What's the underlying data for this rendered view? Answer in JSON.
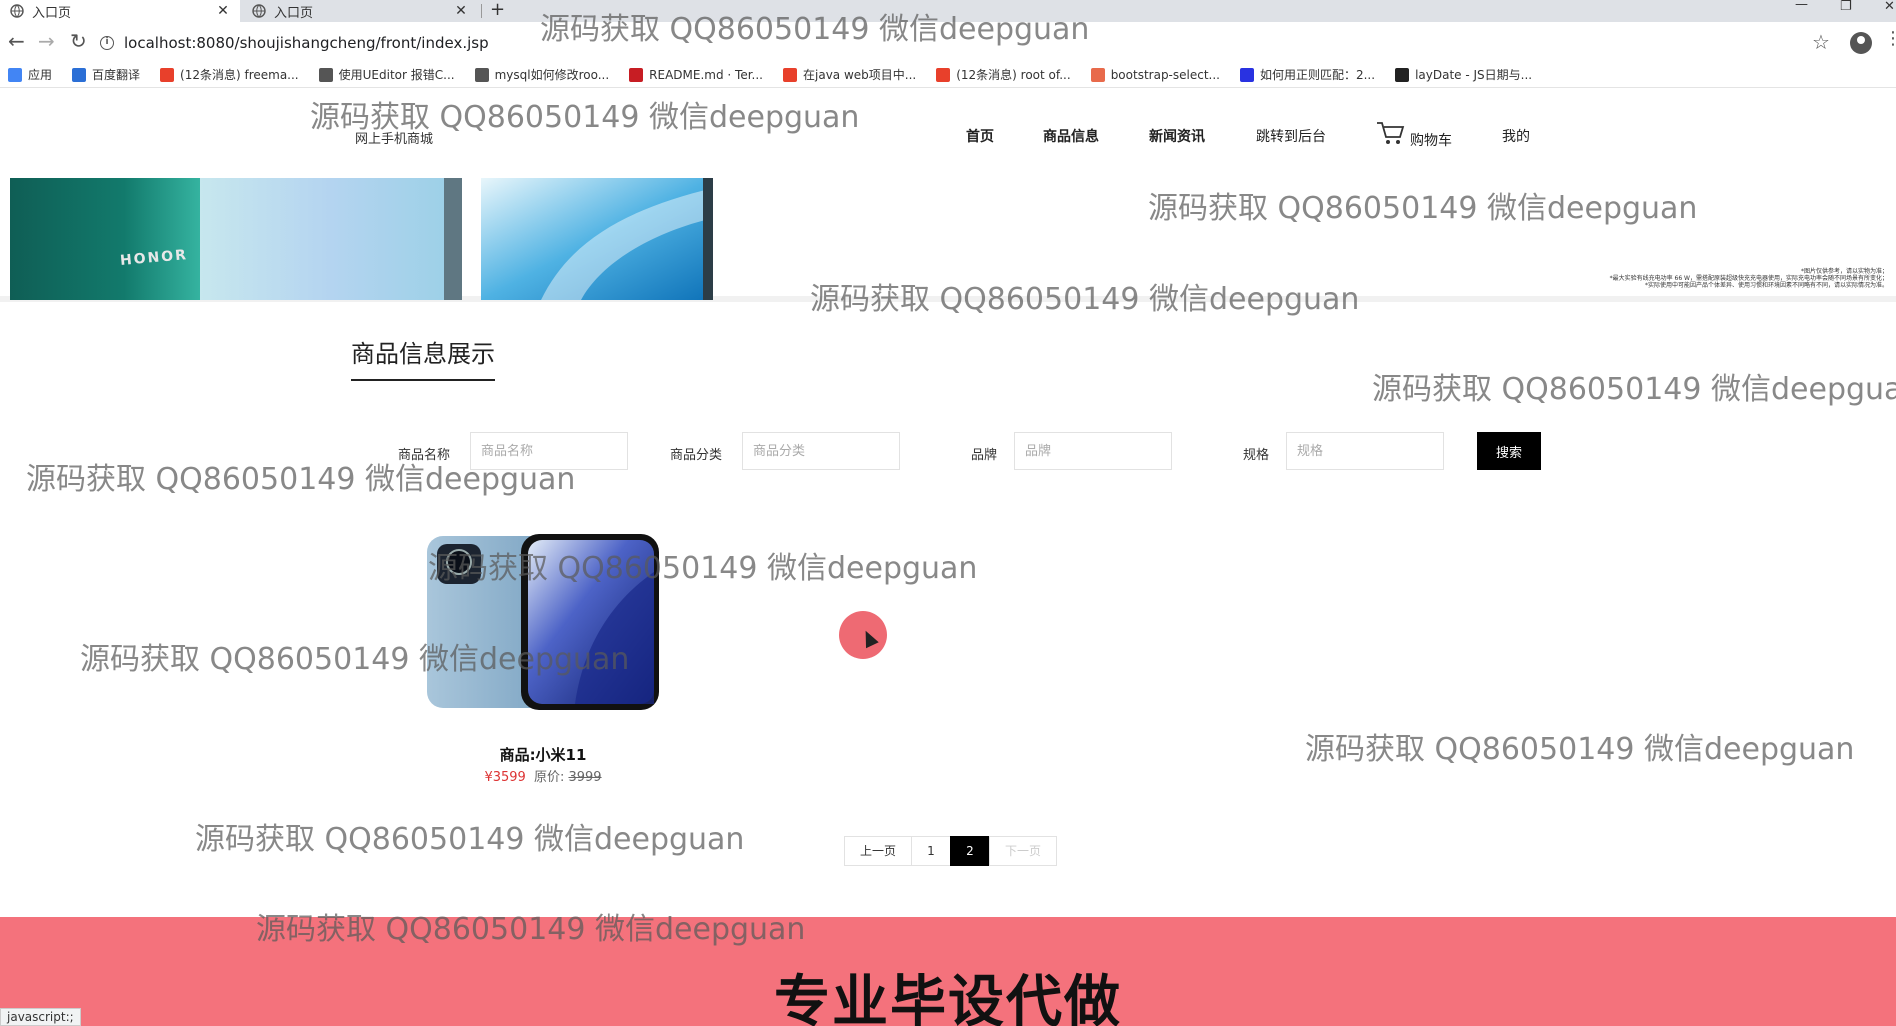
{
  "browser": {
    "tabs": [
      {
        "title": "入口页",
        "active": true
      },
      {
        "title": "入口页",
        "active": false
      }
    ],
    "new_tab_symbol": "+",
    "url": "localhost:8080/shoujishangcheng/front/index.jsp",
    "bookmarks": [
      {
        "label": "应用",
        "icon": "apps-grid-icon",
        "color": "#4285f4"
      },
      {
        "label": "百度翻译",
        "icon": "baidu-translate-icon",
        "color": "#2b6fd6"
      },
      {
        "label": "(12条消息) freema...",
        "icon": "csdn-icon",
        "color": "#e8402b"
      },
      {
        "label": "使用UEditor 报错C...",
        "icon": "wolf-icon",
        "color": "#555555"
      },
      {
        "label": "mysql如何修改roo...",
        "icon": "wolf-icon",
        "color": "#555555"
      },
      {
        "label": "README.md · Ter...",
        "icon": "gitee-icon",
        "color": "#c71d23"
      },
      {
        "label": "在java web项目中...",
        "icon": "csdn-icon",
        "color": "#e8402b"
      },
      {
        "label": "(12条消息) root of...",
        "icon": "csdn-icon",
        "color": "#e8402b"
      },
      {
        "label": "bootstrap-select...",
        "icon": "m-icon",
        "color": "#e86a4b"
      },
      {
        "label": "如何用正则匹配：2...",
        "icon": "baidu-paw-icon",
        "color": "#2932e1"
      },
      {
        "label": "layDate - JS日期与...",
        "icon": "laydate-icon",
        "color": "#222222"
      }
    ],
    "status_text": "javascript:;"
  },
  "site": {
    "name": "网上手机商城",
    "nav": [
      {
        "label": "首页",
        "bold": true
      },
      {
        "label": "商品信息",
        "bold": true
      },
      {
        "label": "新闻资讯",
        "bold": true
      },
      {
        "label": "跳转到后台",
        "bold": false
      },
      {
        "label": "购物车",
        "bold": false
      },
      {
        "label": "我的",
        "bold": false
      }
    ]
  },
  "banner": {
    "brand_text": "HONOR",
    "disclaimer_line1": "*图片仅供参考，请以实物为准；",
    "disclaimer_line2": "*最大实验有线充电功率 66 W，需搭配原装超级快充充电器使用，实际充电功率会随不同场景有所变化；",
    "disclaimer_line3": "*实际使用中可能因产品个体差异、使用习惯和环境因素不同略有不同，请以实际情况为准。"
  },
  "section": {
    "title": "商品信息展示"
  },
  "search": {
    "fields": [
      {
        "label": "商品名称",
        "placeholder": "商品名称"
      },
      {
        "label": "商品分类",
        "placeholder": "商品分类"
      },
      {
        "label": "品牌",
        "placeholder": "品牌"
      },
      {
        "label": "规格",
        "placeholder": "规格"
      }
    ],
    "button_label": "搜索"
  },
  "products": [
    {
      "name": "商品:小米11",
      "price": "¥3599",
      "orig_label": "原价:",
      "orig_price": "3999"
    }
  ],
  "pagination": {
    "prev": "上一页",
    "pages": [
      "1",
      "2"
    ],
    "current": "2",
    "next": "下一页"
  },
  "ad": {
    "text": "专业毕设代做"
  },
  "watermark": {
    "text": "源码获取 QQ86050149 微信deepguan"
  },
  "colors": {
    "accent": "#000000",
    "price": "#dd3333",
    "ad_bar": "#f4727c"
  }
}
